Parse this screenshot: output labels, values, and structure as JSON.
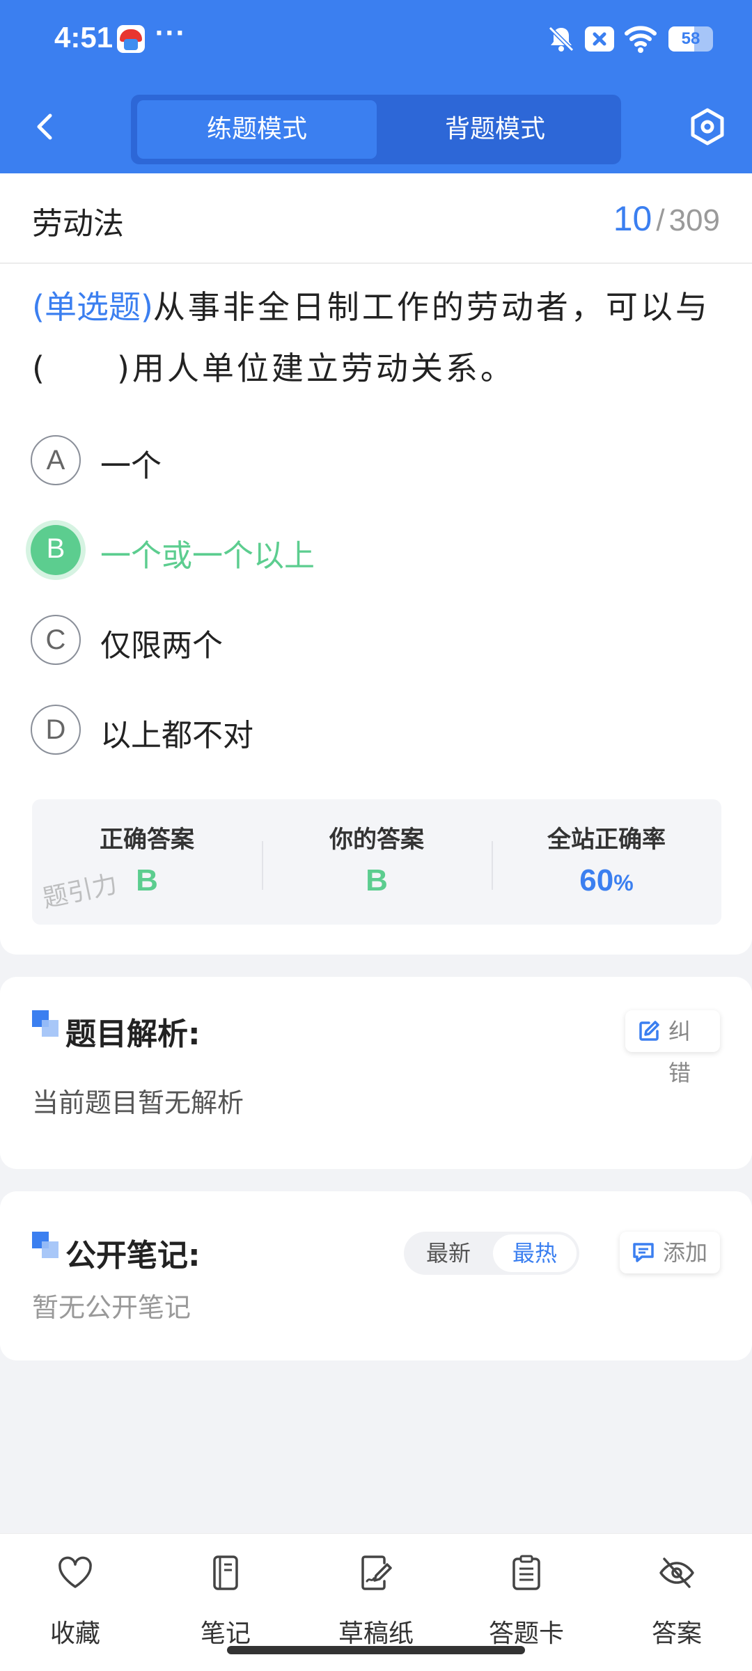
{
  "status_bar": {
    "time": "4:51",
    "more": "···",
    "battery_level": "58",
    "icons": [
      "bell-off-icon",
      "close-badge-icon",
      "wifi-icon",
      "battery-icon"
    ]
  },
  "nav": {
    "mode_tabs": [
      {
        "label": "练题模式",
        "active": true
      },
      {
        "label": "背题模式",
        "active": false
      }
    ],
    "back_icon": "chevron-left-icon",
    "settings_icon": "settings-hexagon-icon"
  },
  "question": {
    "subject": "劳动法",
    "current": "10",
    "separator": "/",
    "total": "309",
    "type_label": "(单选题)",
    "stem": "从事非全日制工作的劳动者，可以与(　　)用人单位建立劳动关系。",
    "options": [
      {
        "letter": "A",
        "text": "一个",
        "state": "normal"
      },
      {
        "letter": "B",
        "text": "一个或一个以上",
        "state": "correct"
      },
      {
        "letter": "C",
        "text": "仅限两个",
        "state": "normal"
      },
      {
        "letter": "D",
        "text": "以上都不对",
        "state": "normal"
      }
    ]
  },
  "answer_panel": {
    "correct_label": "正确答案",
    "correct_value": "B",
    "your_label": "你的答案",
    "your_value": "B",
    "rate_label": "全站正确率",
    "rate_value": "60",
    "rate_unit": "%",
    "watermark": "题引力"
  },
  "analysis": {
    "title": "题目解析:",
    "report_button": "纠错",
    "content": "当前题目暂无解析"
  },
  "notes": {
    "title": "公开笔记:",
    "sort_latest": "最新",
    "sort_hot": "最热",
    "add_button": "添加",
    "empty": "暂无公开笔记"
  },
  "bottom_bar": {
    "items": [
      {
        "label": "收藏",
        "icon": "heart-icon"
      },
      {
        "label": "笔记",
        "icon": "notebook-icon"
      },
      {
        "label": "草稿纸",
        "icon": "draft-paper-icon"
      },
      {
        "label": "答题卡",
        "icon": "answer-sheet-icon"
      },
      {
        "label": "答案",
        "icon": "eye-off-icon"
      }
    ]
  },
  "colors": {
    "primary": "#3b7ff0",
    "correct": "#5ccd8f",
    "background": "#f2f3f6"
  }
}
